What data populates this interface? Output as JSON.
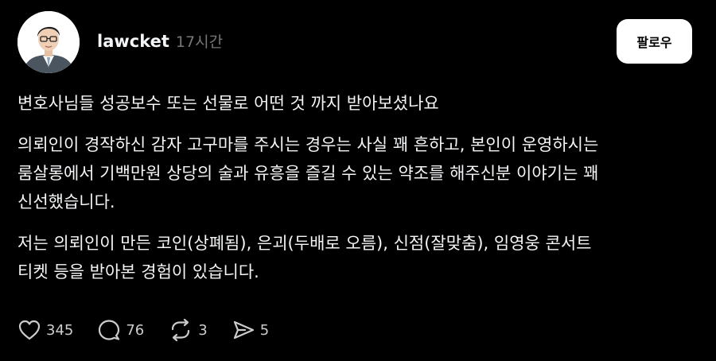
{
  "post": {
    "username": "lawcket",
    "time": "17시간",
    "follow_label": "팔로우",
    "paragraphs": [
      "변호사님들 성공보수 또는 선물로 어떤 것 까지 받아보셨나요",
      "의뢰인이 경작하신 감자 고구마를 주시는 경우는 사실 꽤 흔하고, 본인이 운영하시는\n룸살롱에서 기백만원 상당의 술과 유흥을 즐길 수 있는 약조를 해주신분 이야기는 꽤\n신선했습니다.",
      "저는 의뢰인이 만든 코인(상폐됨), 은괴(두배로 오름), 신점(잘맞춤), 임영웅 콘서트\n티켓 등을 받아본 경험이 있습니다."
    ],
    "actions": {
      "likes": "345",
      "replies": "76",
      "reposts": "3",
      "shares": "5"
    }
  },
  "colors": {
    "background": "#000000",
    "text": "#f3f5f7",
    "muted": "#777777",
    "button_bg": "#ffffff"
  }
}
